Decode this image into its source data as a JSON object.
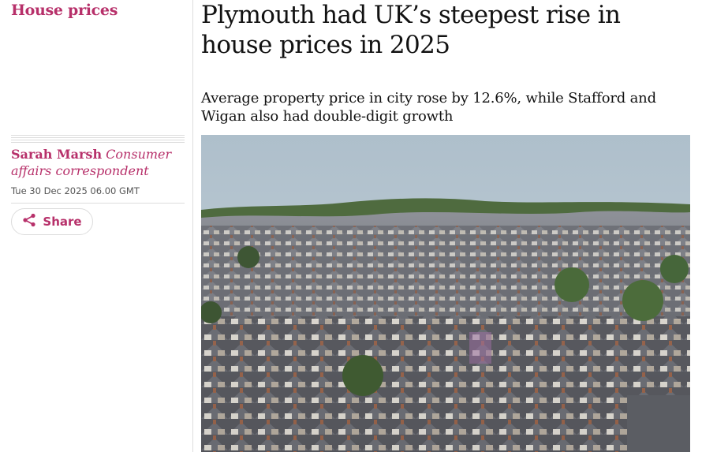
{
  "section": {
    "label": "House prices"
  },
  "byline": {
    "author": "Sarah Marsh",
    "role": "Consumer affairs correspondent"
  },
  "dateline": "Tue 30 Dec 2025 06.00 GMT",
  "share": {
    "label": "Share"
  },
  "headline": "Plymouth had UK’s steepest rise in house prices in 2025",
  "standfirst": "Average property price in city rose by 12.6%, while Stafford and Wigan also had double-digit growth",
  "colors": {
    "accent": "#b7306a",
    "text": "#121212",
    "rule": "#dcdcdc",
    "sky": "#b9c7d1"
  },
  "icons": {
    "share": "share-icon"
  }
}
